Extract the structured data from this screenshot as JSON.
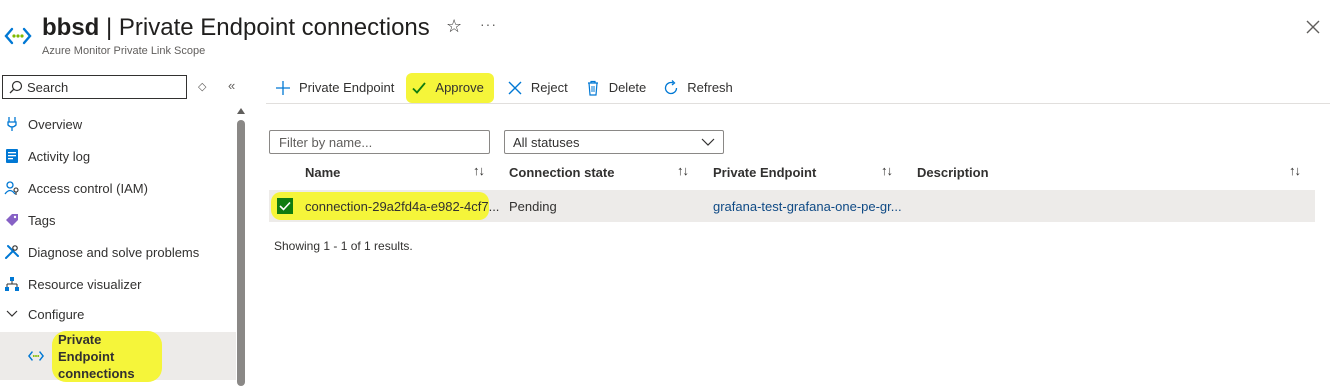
{
  "header": {
    "resource_name": "bbsd",
    "separator": "|",
    "page_name": "Private Endpoint connections",
    "subtitle": "Azure Monitor Private Link Scope",
    "resource_icon": "private-link-scope-icon",
    "favorite_icon": "star-icon",
    "more_icon": "more-icon",
    "more_glyph": "···",
    "close_icon": "close-icon"
  },
  "sidebar": {
    "search_placeholder": "Search",
    "collapse_glyph": "«",
    "sort_glyph": "◇",
    "items": [
      {
        "label": "Overview",
        "icon": "overview-icon"
      },
      {
        "label": "Activity log",
        "icon": "activity-log-icon"
      },
      {
        "label": "Access control (IAM)",
        "icon": "iam-icon"
      },
      {
        "label": "Tags",
        "icon": "tag-icon"
      },
      {
        "label": "Diagnose and solve problems",
        "icon": "wrench-icon"
      },
      {
        "label": "Resource visualizer",
        "icon": "visualizer-icon"
      },
      {
        "label": "Configure",
        "icon": "chevron-down-icon"
      },
      {
        "label": "Private Endpoint connections",
        "icon": "private-link-scope-icon"
      }
    ]
  },
  "toolbar": {
    "add_label": "Private Endpoint",
    "approve_label": "Approve",
    "reject_label": "Reject",
    "delete_label": "Delete",
    "refresh_label": "Refresh"
  },
  "filters": {
    "name_placeholder": "Filter by name...",
    "status_value": "All statuses"
  },
  "table": {
    "columns": [
      "Name",
      "Connection state",
      "Private Endpoint",
      "Description"
    ],
    "sort_glyph": "↑↓",
    "rows": [
      {
        "selected": true,
        "name": "connection-29a2fd4a-e982-4cf7...",
        "state": "Pending",
        "private_endpoint": "grafana-test-grafana-one-pe-gr...",
        "description": ""
      }
    ],
    "results_text": "Showing 1 - 1 of 1 results."
  },
  "colors": {
    "highlight": "#f5f53a",
    "checkbox": "#107c10",
    "link": "#0f4a85",
    "selected_row": "#edebe9"
  }
}
